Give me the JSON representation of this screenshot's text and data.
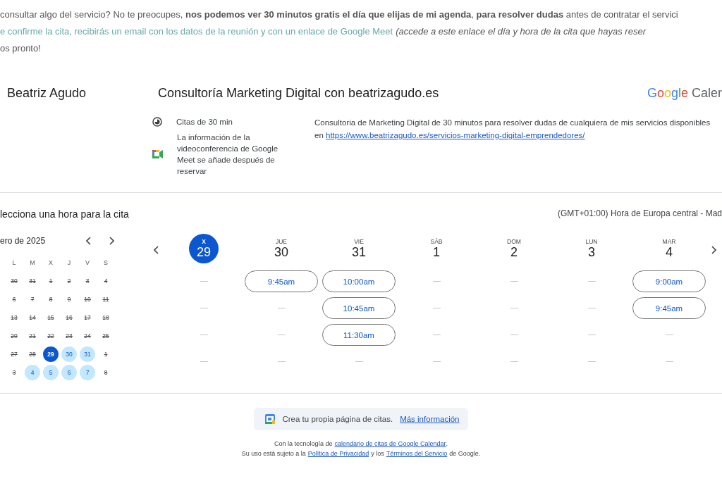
{
  "intro": {
    "line1": "consultar algo del servicio? No te preocupes, **nos podemos ver 30 minutos gratis el día que elijas de mi agenda**, **para resolver dudas** antes de contratar el servici",
    "line2_highlight": "e confirme la cita, recibirás un email con los datos de la reunión y con un enlace de Google Meet",
    "line2_note": "(accede a este enlace el día y hora de la cita que hayas reser",
    "line3": "os pronto!"
  },
  "header": {
    "owner": "Beatriz Agudo",
    "title": "Consultoría Marketing Digital con beatrizagudo.es",
    "logo_brand": "Google",
    "logo_product": "Caler"
  },
  "details": {
    "duration": "Citas de 30 min",
    "meet_info": "La información de la videoconferencia de Google Meet se añade después de reservar",
    "description": "Consultoria de Marketing Digital de 30 minutos para resolver dudas de cualquiera de mis servicios disponibles en",
    "description_link": "https://www.beatrizagudo.es/servicios-marketing-digital-emprendedores/"
  },
  "booking": {
    "title": "lecciona una hora para la cita",
    "timezone": "(GMT+01:00) Hora de Europa central - Mad"
  },
  "mini_calendar": {
    "month": "ero de 2025",
    "weekdays": [
      "L",
      "M",
      "X",
      "J",
      "V",
      "S"
    ],
    "weeks": [
      [
        {
          "day": "30",
          "available": false,
          "selected": false
        },
        {
          "day": "31",
          "available": false,
          "selected": false
        },
        {
          "day": "1",
          "available": false,
          "selected": false
        },
        {
          "day": "2",
          "available": false,
          "selected": false
        },
        {
          "day": "3",
          "available": false,
          "selected": false
        },
        {
          "day": "4",
          "available": false,
          "selected": false
        }
      ],
      [
        {
          "day": "6",
          "available": false,
          "selected": false
        },
        {
          "day": "7",
          "available": false,
          "selected": false
        },
        {
          "day": "8",
          "available": false,
          "selected": false
        },
        {
          "day": "9",
          "available": false,
          "selected": false
        },
        {
          "day": "10",
          "available": false,
          "selected": false
        },
        {
          "day": "11",
          "available": false,
          "selected": false
        }
      ],
      [
        {
          "day": "13",
          "available": false,
          "selected": false
        },
        {
          "day": "14",
          "available": false,
          "selected": false
        },
        {
          "day": "15",
          "available": false,
          "selected": false
        },
        {
          "day": "16",
          "available": false,
          "selected": false
        },
        {
          "day": "17",
          "available": false,
          "selected": false
        },
        {
          "day": "18",
          "available": false,
          "selected": false
        }
      ],
      [
        {
          "day": "20",
          "available": false,
          "selected": false
        },
        {
          "day": "21",
          "available": false,
          "selected": false
        },
        {
          "day": "22",
          "available": false,
          "selected": false
        },
        {
          "day": "23",
          "available": false,
          "selected": false
        },
        {
          "day": "24",
          "available": false,
          "selected": false
        },
        {
          "day": "25",
          "available": false,
          "selected": false
        }
      ],
      [
        {
          "day": "27",
          "available": false,
          "selected": false
        },
        {
          "day": "28",
          "available": false,
          "selected": false
        },
        {
          "day": "29",
          "available": true,
          "selected": true
        },
        {
          "day": "30",
          "available": true,
          "selected": false
        },
        {
          "day": "31",
          "available": true,
          "selected": false
        },
        {
          "day": "1",
          "available": false,
          "selected": false
        }
      ],
      [
        {
          "day": "3",
          "available": false,
          "selected": false
        },
        {
          "day": "4",
          "available": true,
          "selected": false
        },
        {
          "day": "5",
          "available": true,
          "selected": false
        },
        {
          "day": "6",
          "available": true,
          "selected": false
        },
        {
          "day": "7",
          "available": true,
          "selected": false
        },
        {
          "day": "8",
          "available": false,
          "selected": false
        }
      ]
    ]
  },
  "week": [
    {
      "weekday": "X",
      "date": "29",
      "selected": true
    },
    {
      "weekday": "JUE",
      "date": "30",
      "selected": false,
      "slots": [
        "9:45am"
      ]
    },
    {
      "weekday": "VIE",
      "date": "31",
      "selected": false,
      "slots": [
        "10:00am",
        "10:45am",
        "11:30am"
      ]
    },
    {
      "weekday": "SÁB",
      "date": "1",
      "selected": false
    },
    {
      "weekday": "DOM",
      "date": "2",
      "selected": false
    },
    {
      "weekday": "LUN",
      "date": "3",
      "selected": false
    },
    {
      "weekday": "MAR",
      "date": "4",
      "selected": false,
      "slots": [
        "9:00am",
        "9:45am"
      ]
    }
  ],
  "promo": {
    "text": "Crea tu propia página de citas.",
    "link": "Más información"
  },
  "footer": {
    "line1_prefix": "Con la tecnología de",
    "line1_link": "calendario de citas de Google Calendar",
    "line1_suffix": ".",
    "line2_prefix": "Su uso está sujeto a la",
    "line2_link1": "Política de Privacidad",
    "line2_middle": "y los",
    "line2_link2": "Términos del Servicio",
    "line2_suffix": "de Google."
  }
}
